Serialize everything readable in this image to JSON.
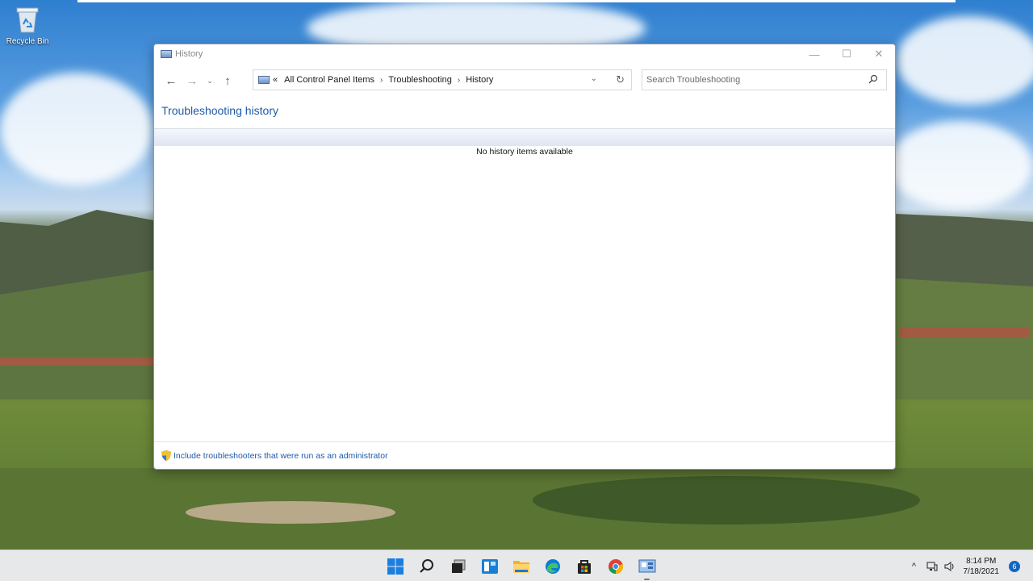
{
  "desktop": {
    "recycle_bin_label": "Recycle Bin"
  },
  "window": {
    "title": "History",
    "controls": {
      "minimize": "—",
      "maximize": "☐",
      "close": "✕"
    },
    "nav": {
      "back": "←",
      "forward": "→",
      "recent": "⌄",
      "up": "↑"
    },
    "address": {
      "prefix": "«",
      "crumbs": [
        "All Control Panel Items",
        "Troubleshooting",
        "History"
      ],
      "separator": "›"
    },
    "search": {
      "placeholder": "Search Troubleshooting"
    },
    "page_title": "Troubleshooting history",
    "empty_message": "No history items available",
    "footer_link": "Include troubleshooters that were run as an administrator"
  },
  "taskbar": {
    "apps": [
      {
        "icon": "windows-start-icon"
      },
      {
        "icon": "search-icon"
      },
      {
        "icon": "task-view-icon"
      },
      {
        "icon": "widgets-icon"
      },
      {
        "icon": "file-explorer-icon"
      },
      {
        "icon": "edge-icon"
      },
      {
        "icon": "store-icon"
      },
      {
        "icon": "chrome-icon"
      },
      {
        "icon": "control-panel-icon",
        "running": true
      }
    ],
    "tray": {
      "chevron": "^",
      "time": "8:14 PM",
      "date": "7/18/2021",
      "notifications": "6"
    }
  },
  "colors": {
    "accent": "#1f5aa8",
    "taskbar": "#e6e8ea",
    "badge": "#1266c4"
  }
}
